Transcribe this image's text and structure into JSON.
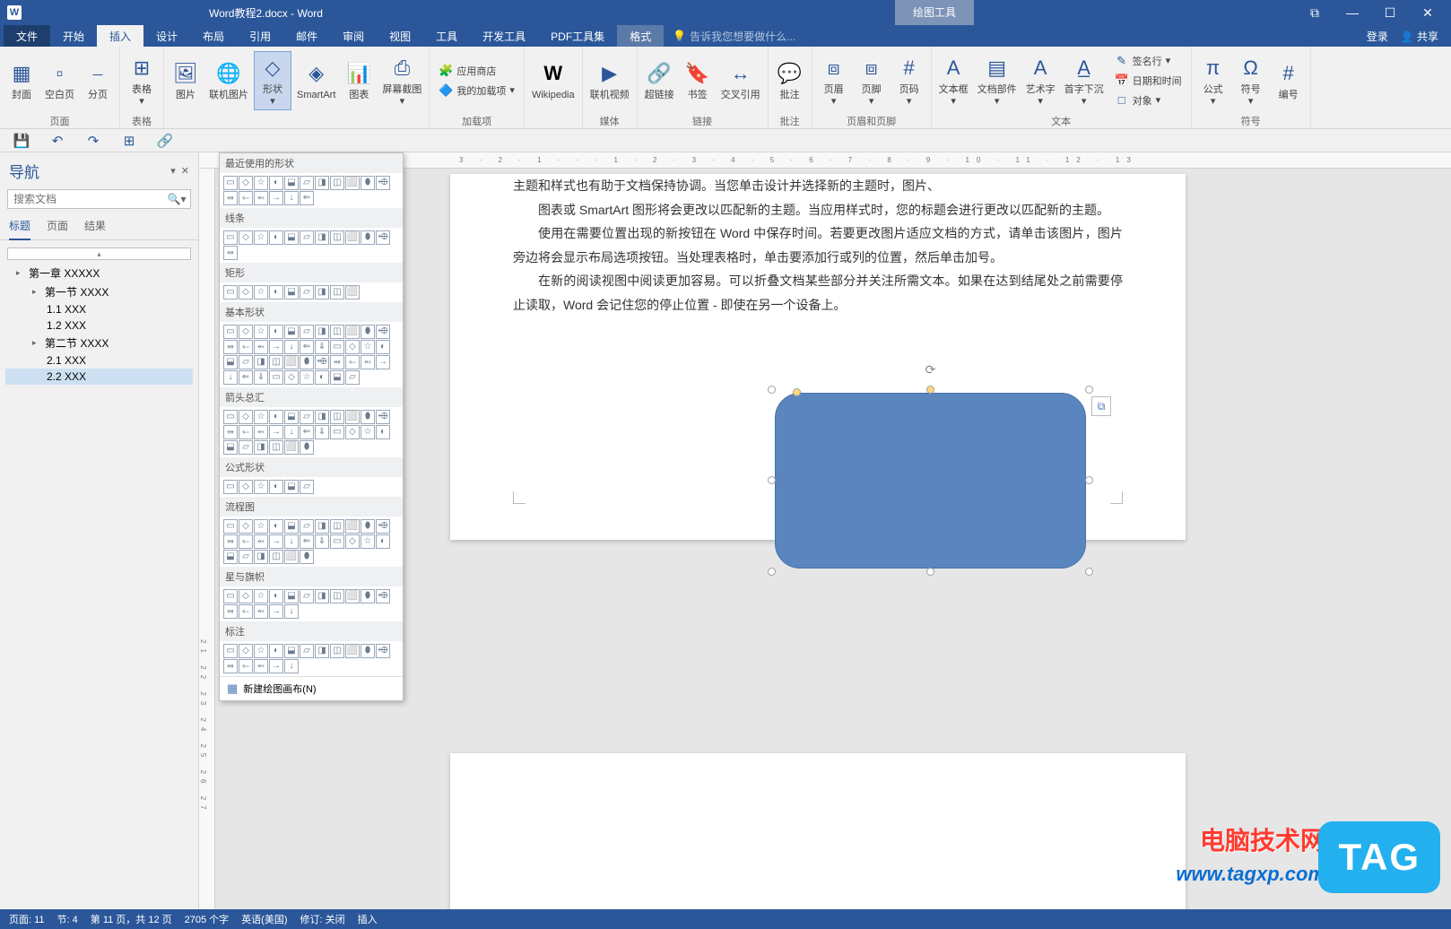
{
  "titlebar": {
    "document_title": "Word教程2.docx - Word",
    "context_tool": "绘图工具",
    "window_buttons": {
      "restore": "⧉",
      "minimize": "—",
      "maximize": "☐",
      "close": "✕"
    }
  },
  "ribbon_tabs": {
    "file": "文件",
    "tabs": [
      "开始",
      "插入",
      "设计",
      "布局",
      "引用",
      "邮件",
      "审阅",
      "视图",
      "工具",
      "开发工具",
      "PDF工具集"
    ],
    "active": "插入",
    "context_tab": "格式",
    "tellme_placeholder": "告诉我您想要做什么...",
    "login": "登录",
    "share": "共享"
  },
  "ribbon": {
    "groups": {
      "page": {
        "label": "页面",
        "items": {
          "cover": "封面",
          "blank": "空白页",
          "break": "分页"
        }
      },
      "tables": {
        "label": "表格",
        "items": {
          "table": "表格"
        }
      },
      "illustrations": {
        "items": {
          "pic": "图片",
          "online_pic": "联机图片",
          "shapes": "形状",
          "smartart": "SmartArt",
          "chart": "图表",
          "screenshot": "屏幕截图"
        }
      },
      "addins": {
        "label": "加载项",
        "items": {
          "store": "应用商店",
          "my": "我的加载项"
        }
      },
      "wikipedia": "Wikipedia",
      "media": {
        "label": "媒体",
        "items": {
          "video": "联机视频"
        }
      },
      "links": {
        "label": "链接",
        "items": {
          "hyperlink": "超链接",
          "bookmark": "书签",
          "crossref": "交叉引用"
        }
      },
      "comments": {
        "label": "批注",
        "items": {
          "comment": "批注"
        }
      },
      "headerfooter": {
        "label": "页眉和页脚",
        "items": {
          "header": "页眉",
          "footer": "页脚",
          "pagenum": "页码"
        }
      },
      "text": {
        "label": "文本",
        "items": {
          "textbox": "文本框",
          "quickparts": "文档部件",
          "wordart": "艺术字",
          "dropcap": "首字下沉",
          "sigline": "签名行",
          "datetime": "日期和时间",
          "object": "对象"
        }
      },
      "symbols": {
        "label": "符号",
        "items": {
          "equation": "公式",
          "symbol": "符号",
          "number": "编号"
        }
      }
    }
  },
  "qat": [
    "save",
    "undo",
    "redo",
    "table",
    "link"
  ],
  "nav": {
    "title": "导航",
    "search_placeholder": "搜索文档",
    "tabs": {
      "headings": "标题",
      "pages": "页面",
      "results": "结果"
    },
    "tree": [
      {
        "lvl": 1,
        "caret": "▸",
        "text": "第一章 XXXXX"
      },
      {
        "lvl": 2,
        "caret": "▸",
        "text": "第一节 XXXX"
      },
      {
        "lvl": 3,
        "text": "1.1 XXX"
      },
      {
        "lvl": 3,
        "text": "1.2 XXX"
      },
      {
        "lvl": 2,
        "caret": "▸",
        "text": "第二节 XXXX"
      },
      {
        "lvl": 3,
        "text": "2.1 XXX"
      },
      {
        "lvl": 3,
        "text": "2.2 XXX",
        "selected": true
      }
    ]
  },
  "shapes_dropdown": {
    "sections": [
      {
        "h": "最近使用的形状",
        "rows": 2,
        "count": 17
      },
      {
        "h": "线条",
        "rows": 1,
        "count": 12
      },
      {
        "h": "矩形",
        "rows": 1,
        "count": 9
      },
      {
        "h": "基本形状",
        "rows": 4,
        "count": 42
      },
      {
        "h": "箭头总汇",
        "rows": 3,
        "count": 28
      },
      {
        "h": "公式形状",
        "rows": 1,
        "count": 6
      },
      {
        "h": "流程图",
        "rows": 3,
        "count": 28
      },
      {
        "h": "星与旗帜",
        "rows": 2,
        "count": 16
      },
      {
        "h": "标注",
        "rows": 2,
        "count": 16
      }
    ],
    "canvas_link": "新建绘图画布(N)"
  },
  "document": {
    "paragraphs": [
      "图表或 SmartArt 图形将会更改以匹配新的主题。当应用样式时，您的标题会进行更改以匹配新的主题。",
      "使用在需要位置出现的新按钮在 Word 中保存时间。若要更改图片适应文档的方式，请单击该图片，图片旁边将会显示布局选项按钮。当处理表格时，单击要添加行或列的位置，然后单击加号。",
      "在新的阅读视图中阅读更加容易。可以折叠文档某些部分并关注所需文本。如果在达到结尾处之前需要停止读取，Word 会记住您的停止位置 - 即使在另一个设备上。"
    ],
    "truncated_top": "主题和样式也有助于文档保持协调。当您单击设计并选择新的主题时，图片、",
    "page_number": "11"
  },
  "ruler": {
    "h": "3 · 2 · 1 · · · 1 · 2 · 3 · 4 · 5 · 6 · 7 · 8 · 9 · 10 · 11 · 12 · 13",
    "v": "21 22 23 24 25 26 27"
  },
  "statusbar": {
    "page": "页面: 11",
    "section": "节: 4",
    "pages": "第 11 页，共 12 页",
    "words": "2705 个字",
    "lang": "英语(美国)",
    "revise": "修订: 关闭",
    "mode": "插入"
  },
  "watermarks": {
    "line1": "电脑技术网",
    "line2": "www.tagxp.com",
    "tag": "TAG"
  }
}
